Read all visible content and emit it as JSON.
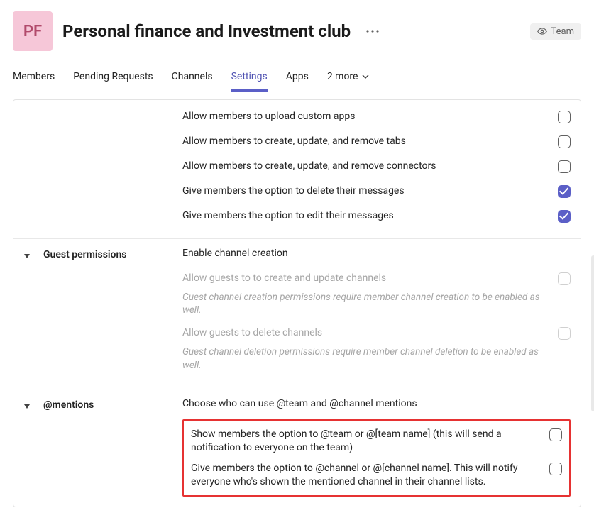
{
  "header": {
    "avatar_initials": "PF",
    "title": "Personal finance and Investment club",
    "team_pill_label": "Team"
  },
  "tabs": {
    "items": [
      "Members",
      "Pending Requests",
      "Channels",
      "Settings",
      "Apps"
    ],
    "active_index": 3,
    "more_label": "2 more"
  },
  "sections": {
    "member_permissions": {
      "options": [
        {
          "label": "Allow members to upload custom apps",
          "checked": false
        },
        {
          "label": "Allow members to create, update, and remove tabs",
          "checked": false
        },
        {
          "label": "Allow members to create, update, and remove connectors",
          "checked": false
        },
        {
          "label": "Give members the option to delete their messages",
          "checked": true
        },
        {
          "label": "Give members the option to edit their messages",
          "checked": true
        }
      ]
    },
    "guest_permissions": {
      "label": "Guest permissions",
      "header": "Enable channel creation",
      "options": [
        {
          "label": "Allow guests to to create and update channels",
          "disabled": true,
          "help": "Guest channel creation permissions require member channel creation to be enabled as well."
        },
        {
          "label": "Allow guests to delete channels",
          "disabled": true,
          "help": "Guest channel deletion permissions require member channel deletion to be enabled as well."
        }
      ]
    },
    "mentions": {
      "label": "@mentions",
      "header": "Choose who can use @team and @channel mentions",
      "options": [
        {
          "label": "Show members the option to @team or @[team name] (this will send a notification to everyone on the team)",
          "checked": false
        },
        {
          "label": "Give members the option to @channel or @[channel name]. This will notify everyone who's shown the mentioned channel in their channel lists.",
          "checked": false
        }
      ]
    }
  }
}
